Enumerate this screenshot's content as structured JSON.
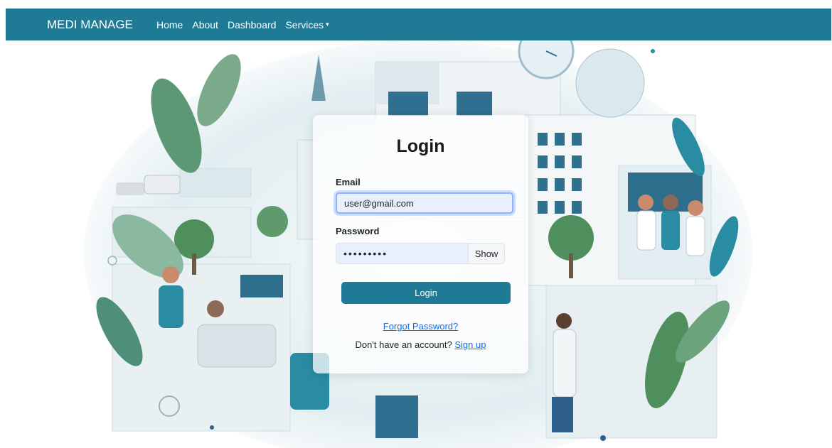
{
  "navbar": {
    "brand": "MEDI MANAGE",
    "links": [
      "Home",
      "About",
      "Dashboard",
      "Services"
    ],
    "services_caret": "▾"
  },
  "login": {
    "title": "Login",
    "email_label": "Email",
    "email_value": "user@gmail.com",
    "password_label": "Password",
    "password_value": "•••••••••",
    "show_label": "Show",
    "submit_label": "Login",
    "forgot_label": "Forgot Password?",
    "signup_prompt": "Don't have an account?",
    "signup_link": "Sign up"
  },
  "colors": {
    "navbar": "#1f7a96",
    "button": "#1f7a96",
    "link": "#0d6efd",
    "illustration_teal": "#2a8ca3",
    "illustration_green": "#4c8c6a"
  }
}
